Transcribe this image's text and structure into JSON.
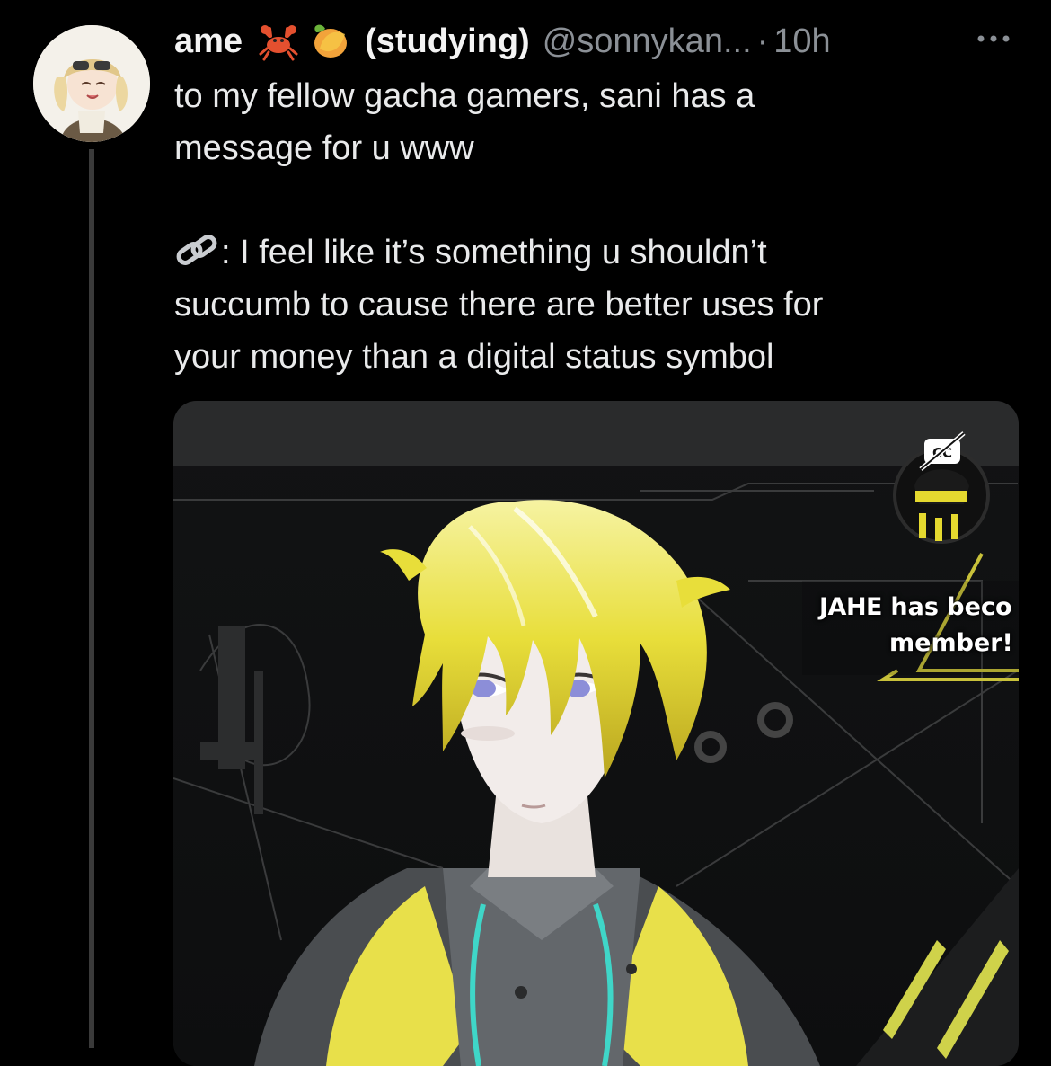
{
  "tweet": {
    "display_name": "ame",
    "name_suffix": "(studying)",
    "handle": "@sonnykan...",
    "separator": "·",
    "time": "10h",
    "emojis": [
      "crab-emoji",
      "mango-emoji"
    ],
    "text_lines_1": [
      "to my fellow gacha gamers, sani has a",
      "message for u www"
    ],
    "quote_prefix": ": ",
    "text_lines_2": [
      "I feel like it’s something u shouldn’t",
      "succumb to cause there are better uses for",
      "your money than a digital status symbol"
    ]
  },
  "media": {
    "overlay_name": "JAHE",
    "overlay_line1_rest": " has beco",
    "overlay_line2": "member!"
  },
  "colors": {
    "background": "#000000",
    "text": "#e7e9ea",
    "secondary": "#8b9096",
    "thread_line": "#3a3a3a",
    "accent_yellow": "#e8e04a"
  },
  "icons": {
    "more": "more-horizontal-icon",
    "cc": "closed-captions-off-icon",
    "link": "link-emoji"
  }
}
